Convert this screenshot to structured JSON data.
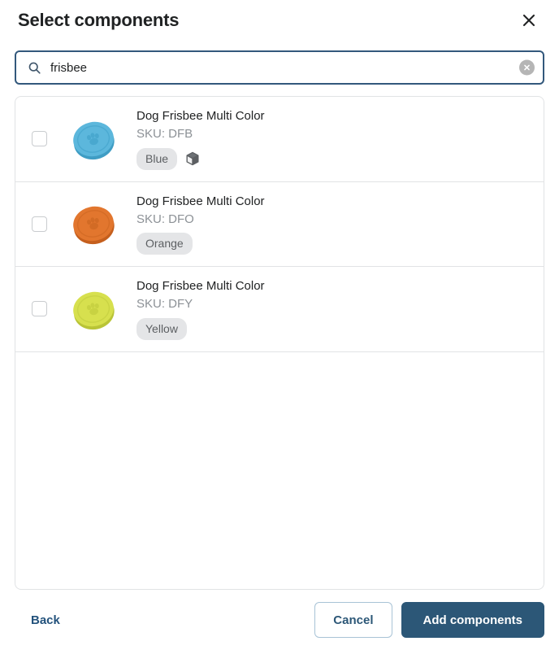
{
  "header": {
    "title": "Select components",
    "close_icon": "close-icon"
  },
  "search": {
    "value": "frisbee",
    "placeholder": "Search components",
    "search_icon": "search-icon",
    "clear_icon": "clear-icon"
  },
  "list": {
    "items": [
      {
        "title": "Dog Frisbee Multi Color",
        "sku": "SKU: DFB",
        "badge": "Blue",
        "has_box_icon": true,
        "checked": false,
        "thumb_color": "#5cb7dc",
        "thumb_shadow": "#3f9dc4",
        "thumb_rim": "#46a6cd"
      },
      {
        "title": "Dog Frisbee Multi Color",
        "sku": "SKU: DFO",
        "badge": "Orange",
        "has_box_icon": false,
        "checked": false,
        "thumb_color": "#e2762e",
        "thumb_shadow": "#c55f1d",
        "thumb_rim": "#d06a24"
      },
      {
        "title": "Dog Frisbee Multi Color",
        "sku": "SKU: DFY",
        "badge": "Yellow",
        "has_box_icon": false,
        "checked": false,
        "thumb_color": "#d7e04e",
        "thumb_shadow": "#b9c437",
        "thumb_rim": "#c6d041"
      }
    ]
  },
  "footer": {
    "back_label": "Back",
    "cancel_label": "Cancel",
    "submit_label": "Add components"
  },
  "colors": {
    "primary": "#2c5777",
    "focus_border": "#33587c",
    "link": "#23527c",
    "text": "#202223",
    "muted": "#8c9196",
    "divider": "#e1e3e5",
    "badge_bg": "#e4e5e7"
  }
}
